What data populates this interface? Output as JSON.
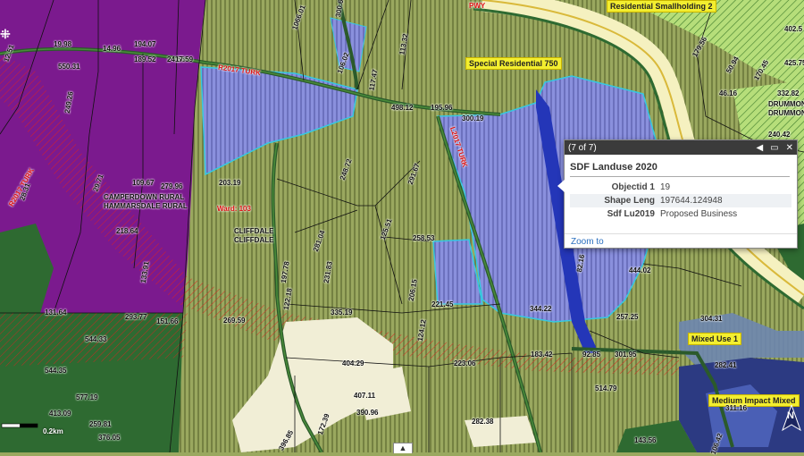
{
  "map": {
    "zone_labels": [
      "Residential Smallholding 2",
      "Special Residential 750",
      "Mixed Use 1",
      "Medium Impact Mixed"
    ],
    "area_labels": [
      "CAMPERDOWN RURAL",
      "HAMMARSDALE RURAL",
      "CLIFFDALE",
      "CLIFFDALE",
      "DRUMMON",
      "DRUMMON"
    ],
    "road_labels": [
      "Ward: 103",
      "R2017 TURK",
      "L2017 TURK",
      "R2017 TURK",
      "PWY"
    ],
    "dimension_labels": [
      "19.98",
      "194.07",
      "189.52",
      "24.66",
      "17.59",
      "550.31",
      "249.26",
      "14.96",
      "12.51",
      "28.31",
      "29.71",
      "109.67",
      "279.96",
      "203.19",
      "218.64",
      "133.91",
      "131.64",
      "293.77",
      "151.66",
      "544.33",
      "544.35",
      "577.19",
      "413.09",
      "259.81",
      "376.05",
      "1066.01",
      "300.6",
      "106.02",
      "117.47",
      "113.32",
      "498.12",
      "195.96",
      "300.19",
      "291.67",
      "248.72",
      "281.04",
      "125.51",
      "258.53",
      "206.15",
      "231.83",
      "124.12",
      "335.19",
      "269.59",
      "122.18",
      "197.78",
      "404.29",
      "223.06",
      "407.11",
      "390.96",
      "282.38",
      "396.85",
      "172.39",
      "344.22",
      "444.02",
      "257.25",
      "221.45",
      "92.85",
      "301.95",
      "183.42",
      "514.79",
      "282.41",
      "304.31",
      "311.16",
      "143.56",
      "106.42",
      "332.82",
      "402.5",
      "425.75",
      "46.16",
      "240.42",
      "179.56",
      "170.45",
      "50.94",
      "82.16"
    ]
  },
  "popup": {
    "count": "(7 of 7)",
    "title": "SDF Landuse 2020",
    "fields": [
      {
        "key": "Objectid 1",
        "value": "19"
      },
      {
        "key": "Shape Leng",
        "value": "197644.124948"
      },
      {
        "key": "Sdf Lu2019",
        "value": "Proposed Business"
      }
    ],
    "zoom_label": "Zoom to"
  },
  "scale": {
    "label": "0.2km"
  },
  "north_label": "N",
  "colors": {
    "rural": "#7b1a8e",
    "special_residential": "#9aa85f",
    "business": "#7e84d6",
    "open_space": "#2f6b2f",
    "sand": "#f1eed6",
    "road": "#2b5a2b",
    "mixed_use": "#2c3a82",
    "smallholding": "#a9d46b"
  }
}
